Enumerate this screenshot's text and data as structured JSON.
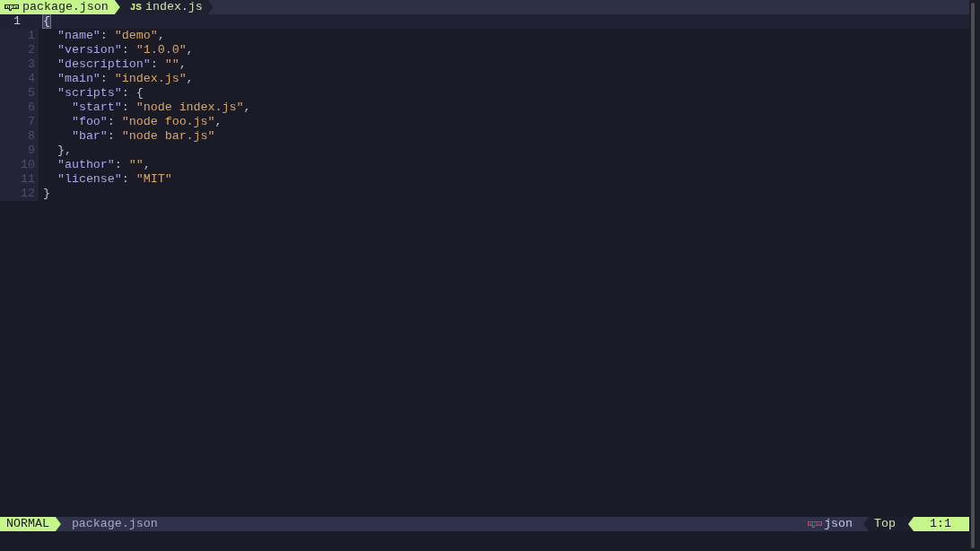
{
  "tabline": {
    "tabs": [
      {
        "label": "package.json",
        "selected": true,
        "kind": "package"
      },
      {
        "label": "index.js",
        "selected": false,
        "kind": "script",
        "glyph": "JS"
      }
    ]
  },
  "editor": {
    "lines": [
      {
        "number": "1",
        "current": true,
        "tokens": [
          {
            "kind": "cursor",
            "text": "{"
          }
        ]
      },
      {
        "number": "1",
        "current": false,
        "tokens": [
          {
            "kind": "key",
            "text": "  \"name\""
          },
          {
            "kind": "punct",
            "text": ": "
          },
          {
            "kind": "string",
            "text": "\"demo\""
          },
          {
            "kind": "punct",
            "text": ","
          }
        ]
      },
      {
        "number": "2",
        "current": false,
        "tokens": [
          {
            "kind": "key",
            "text": "  \"version\""
          },
          {
            "kind": "punct",
            "text": ": "
          },
          {
            "kind": "string",
            "text": "\"1.0.0\""
          },
          {
            "kind": "punct",
            "text": ","
          }
        ]
      },
      {
        "number": "3",
        "current": false,
        "tokens": [
          {
            "kind": "key",
            "text": "  \"description\""
          },
          {
            "kind": "punct",
            "text": ": "
          },
          {
            "kind": "string",
            "text": "\"\""
          },
          {
            "kind": "punct",
            "text": ","
          }
        ]
      },
      {
        "number": "4",
        "current": false,
        "tokens": [
          {
            "kind": "key",
            "text": "  \"main\""
          },
          {
            "kind": "punct",
            "text": ": "
          },
          {
            "kind": "string",
            "text": "\"index.js\""
          },
          {
            "kind": "punct",
            "text": ","
          }
        ]
      },
      {
        "number": "5",
        "current": false,
        "tokens": [
          {
            "kind": "key",
            "text": "  \"scripts\""
          },
          {
            "kind": "punct",
            "text": ": {"
          }
        ]
      },
      {
        "number": "6",
        "current": false,
        "tokens": [
          {
            "kind": "key",
            "text": "    \"start\""
          },
          {
            "kind": "punct",
            "text": ": "
          },
          {
            "kind": "string",
            "text": "\"node index.js\""
          },
          {
            "kind": "punct",
            "text": ","
          }
        ]
      },
      {
        "number": "7",
        "current": false,
        "tokens": [
          {
            "kind": "key",
            "text": "    \"foo\""
          },
          {
            "kind": "punct",
            "text": ": "
          },
          {
            "kind": "string",
            "text": "\"node foo.js\""
          },
          {
            "kind": "punct",
            "text": ","
          }
        ]
      },
      {
        "number": "8",
        "current": false,
        "tokens": [
          {
            "kind": "key",
            "text": "    \"bar\""
          },
          {
            "kind": "punct",
            "text": ": "
          },
          {
            "kind": "string",
            "text": "\"node bar.js\""
          }
        ]
      },
      {
        "number": "9",
        "current": false,
        "tokens": [
          {
            "kind": "punct",
            "text": "  },"
          }
        ]
      },
      {
        "number": "10",
        "current": false,
        "tokens": [
          {
            "kind": "key",
            "text": "  \"author\""
          },
          {
            "kind": "punct",
            "text": ": "
          },
          {
            "kind": "string",
            "text": "\"\""
          },
          {
            "kind": "punct",
            "text": ","
          }
        ]
      },
      {
        "number": "11",
        "current": false,
        "tokens": [
          {
            "kind": "key",
            "text": "  \"license\""
          },
          {
            "kind": "punct",
            "text": ": "
          },
          {
            "kind": "string",
            "text": "\"MIT\""
          }
        ]
      },
      {
        "number": "12",
        "current": false,
        "tokens": [
          {
            "kind": "punct",
            "text": "}"
          }
        ]
      }
    ]
  },
  "statusline": {
    "mode": "NORMAL",
    "file": "package.json",
    "filetype": {
      "kind": "package",
      "label": "json"
    },
    "scroll": "Top",
    "position": "1:1"
  }
}
